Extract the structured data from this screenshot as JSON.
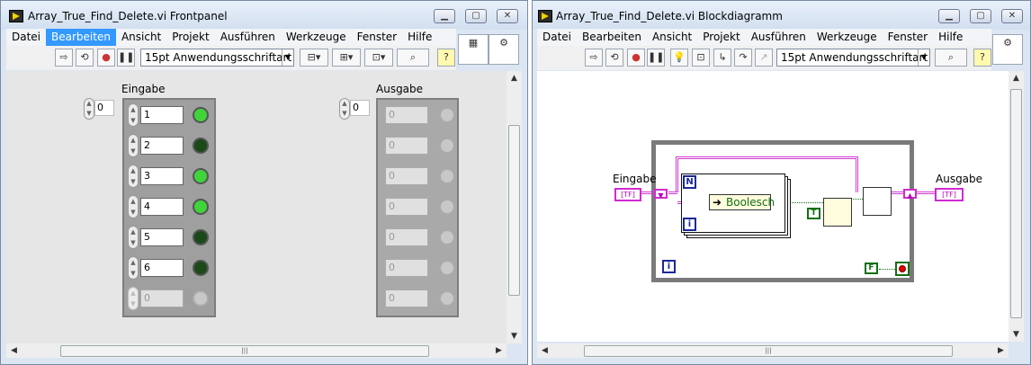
{
  "frontpanel": {
    "title": "Array_True_Find_Delete.vi Frontpanel",
    "menus": [
      "Datei",
      "Bearbeiten",
      "Ansicht",
      "Projekt",
      "Ausführen",
      "Werkzeuge",
      "Fenster",
      "Hilfe"
    ],
    "selected_menu": "Bearbeiten",
    "font": "15pt Anwendungsschriftart",
    "input_label": "Eingabe",
    "output_label": "Ausgabe",
    "input_index": "0",
    "output_index": "0",
    "input_rows": [
      {
        "value": "1",
        "led": "on"
      },
      {
        "value": "2",
        "led": "off"
      },
      {
        "value": "3",
        "led": "on"
      },
      {
        "value": "4",
        "led": "on"
      },
      {
        "value": "5",
        "led": "off"
      },
      {
        "value": "6",
        "led": "off"
      },
      {
        "value": "0",
        "led": "empty"
      }
    ],
    "output_rows": [
      "0",
      "0",
      "0",
      "0",
      "0",
      "0",
      "0"
    ]
  },
  "blockdiagram": {
    "title": "Array_True_Find_Delete.vi Blockdiagramm",
    "menus": [
      "Datei",
      "Bearbeiten",
      "Ansicht",
      "Projekt",
      "Ausführen",
      "Werkzeuge",
      "Fenster",
      "Hilfe"
    ],
    "font": "15pt Anwendungsschriftart",
    "input_label": "Eingabe",
    "output_label": "Ausgabe",
    "unbundle_label": "Boolesch",
    "n_label": "N",
    "i_label": "i",
    "true_const": "T",
    "false_const": "F",
    "terminal_glyph": "[TF]"
  },
  "colors": {
    "led_on": "#3fd43a",
    "led_off": "#1b4a18",
    "wire_cluster": "#d33ad3",
    "while_loop_border": "#7a7a7a",
    "selected_menu_bg": "#3399ff"
  },
  "icons": {
    "window_min": "minimize-icon",
    "window_max": "maximize-icon",
    "window_close": "close-icon"
  }
}
